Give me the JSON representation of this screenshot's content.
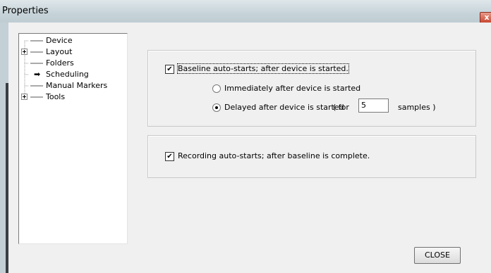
{
  "window": {
    "title": "Properties",
    "close_glyph": "x"
  },
  "tree": {
    "items": [
      {
        "label": "Device",
        "expandable": false
      },
      {
        "label": "Layout",
        "expandable": true
      },
      {
        "label": "Folders",
        "expandable": false
      },
      {
        "label": "Scheduling",
        "expandable": false,
        "selected_arrow": true
      },
      {
        "label": "Manual Markers",
        "expandable": false
      },
      {
        "label": "Tools",
        "expandable": true
      }
    ]
  },
  "baseline": {
    "checkbox_label": "Baseline auto-starts; after device is started.",
    "checked": true,
    "option_immediate": "Immediately after device is started",
    "option_delayed": "Delayed after device is started",
    "for_prefix": "( for",
    "samples_value": "5",
    "samples_suffix": "samples )",
    "selected_option": "delayed"
  },
  "recording": {
    "checkbox_label": "Recording auto-starts; after baseline is complete.",
    "checked": true
  },
  "buttons": {
    "close_label": "CLOSE"
  },
  "glyphs": {
    "check": "✔",
    "arrow": "➡"
  }
}
